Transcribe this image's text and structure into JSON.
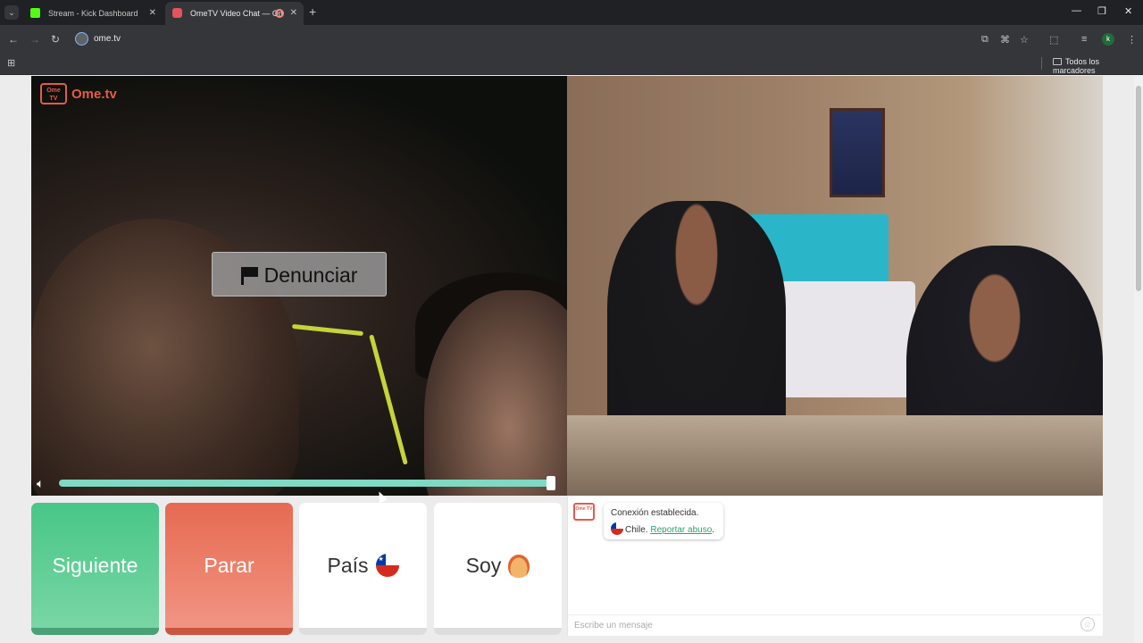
{
  "browser": {
    "tabs": [
      {
        "title": "Stream - Kick Dashboard",
        "active": false
      },
      {
        "title": "OmeTV Video Chat — Ome",
        "active": true
      }
    ],
    "url": "ome.tv",
    "bookmarks_all": "Todos los marcadores",
    "profile_initial": "k"
  },
  "logo": {
    "tv_text": "Ome TV",
    "brand": "Ome.tv"
  },
  "video": {
    "report_button": "Denunciar",
    "volume_percent": 100
  },
  "controls": {
    "next": "Siguiente",
    "stop": "Parar",
    "country": "País",
    "me": "Soy"
  },
  "chat": {
    "status": "Conexión establecida.",
    "country_name": "Chile",
    "report_link": "Reportar abuso",
    "input_placeholder": "Escribe un mensaje"
  },
  "colors": {
    "next": "#48c688",
    "stop": "#e66a51",
    "brand": "#e15c4b",
    "volume": "#7fd9c3"
  }
}
